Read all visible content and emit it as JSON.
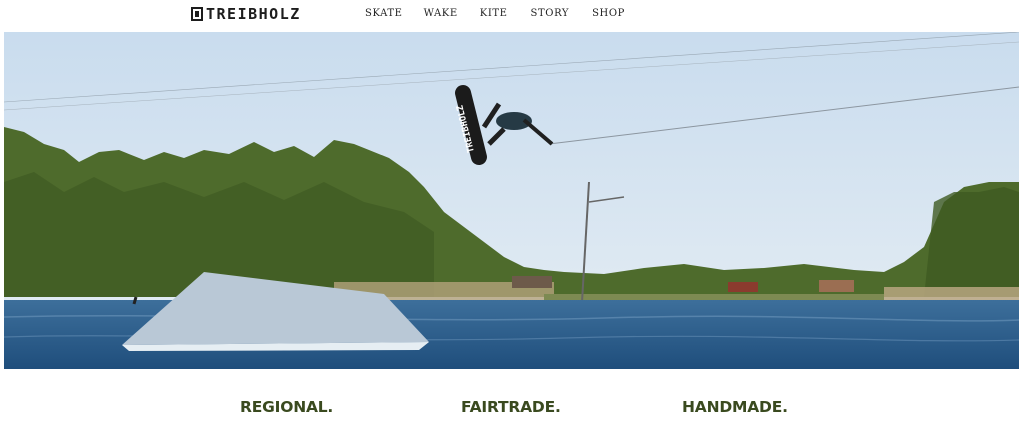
{
  "header": {
    "logo_text": "TREIBHOLZ",
    "nav": [
      "SKATE",
      "WAKE",
      "KITE",
      "STORY",
      "SHOP"
    ]
  },
  "hero": {
    "board_text": "TREIBHOLZ",
    "slider": {
      "count": 6,
      "active_index": 0
    }
  },
  "values": [
    "REGIONAL.",
    "FAIRTRADE.",
    "HANDMADE."
  ],
  "colors": {
    "accent_text": "#3a4a1f",
    "nav_text": "#222222",
    "water": "#2f5f8f",
    "sky": "#d7e6f3"
  }
}
